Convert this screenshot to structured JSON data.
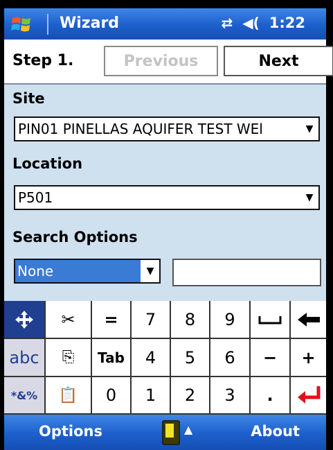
{
  "titlebar": {
    "title": "Wizard",
    "time": "1:22",
    "icons": [
      "windows-start-icon",
      "connectivity-icon",
      "volume-icon"
    ]
  },
  "wizard": {
    "step_label": "Step 1.",
    "previous_label": "Previous",
    "next_label": "Next"
  },
  "form": {
    "site_label": "Site",
    "site_value": "PIN01 PINELLAS AQUIFER TEST WEl",
    "location_label": "Location",
    "location_value": "P501",
    "search_label": "Search Options",
    "search_value": "None",
    "search_text": ""
  },
  "keyboard": {
    "row1": [
      "✥",
      "✂",
      "=",
      "7",
      "8",
      "9",
      "␣",
      "⬅"
    ],
    "row2": [
      "abc",
      "⎘",
      "Tab",
      "4",
      "5",
      "6",
      "−",
      "+"
    ],
    "row3": [
      "*&%",
      "📋",
      "0",
      "1",
      "2",
      "3",
      ".",
      "↵"
    ]
  },
  "menubar": {
    "left": "Options",
    "right": "About"
  },
  "colors": {
    "titlebar": "#1d5fcb",
    "form_bg": "#cfe0ef",
    "selection": "#3a7bd5",
    "enter_red": "#e0101a"
  }
}
